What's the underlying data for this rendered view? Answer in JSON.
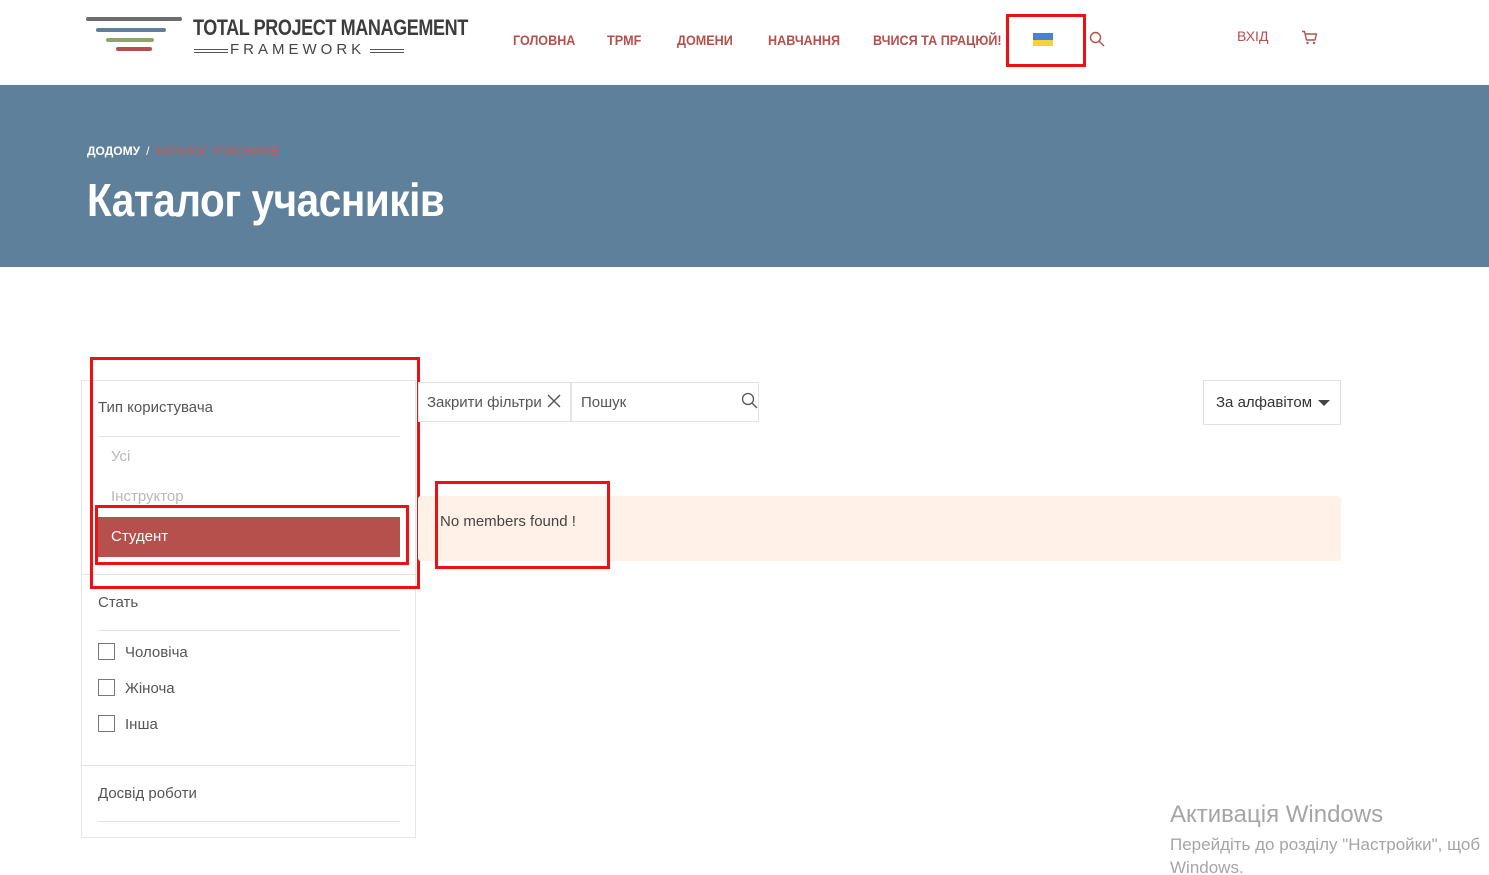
{
  "header": {
    "logo": {
      "title": "TOTAL PROJECT MANAGEMENT",
      "subtitle": "FRAMEWORK"
    },
    "nav": [
      {
        "label": "ГОЛОВНА"
      },
      {
        "label": "TPMF"
      },
      {
        "label": "ДОМЕНИ"
      },
      {
        "label": "НАВЧАННЯ"
      },
      {
        "label": "ВЧИСЯ ТА ПРАЦЮЙ!"
      }
    ],
    "language_flag_icon": "ukraine-flag-icon",
    "login_label": "ВХІД",
    "cart_icon": "cart-icon",
    "accent_color": "#b5504d"
  },
  "banner": {
    "background_color": "#5e809b",
    "breadcrumb": {
      "home": "ДОДОМУ",
      "separator": "/",
      "current": "КАТАЛОГ УЧАСНИКІВ"
    },
    "title": "Каталог учасників"
  },
  "sidebar": {
    "user_type": {
      "title": "Тип користувача",
      "options": [
        {
          "label": "Усі",
          "active": false
        },
        {
          "label": "Інструктор",
          "active": false
        },
        {
          "label": "Студент",
          "active": true
        }
      ]
    },
    "gender": {
      "title": "Стать",
      "options": [
        {
          "label": "Чоловіча",
          "checked": false
        },
        {
          "label": "Жіноча",
          "checked": false
        },
        {
          "label": "Інша",
          "checked": false
        }
      ]
    },
    "experience": {
      "title": "Досвід роботи"
    }
  },
  "toolbar": {
    "close_filters_label": "Закрити фільтри",
    "search_placeholder": "Пошук",
    "sort_label": "За алфавітом"
  },
  "results": {
    "empty_message": "No members found !"
  },
  "windows_watermark": {
    "title": "Активація Windows",
    "line1": "Перейдіть до розділу \"Настройки\", щоб",
    "line2": "Windows."
  }
}
